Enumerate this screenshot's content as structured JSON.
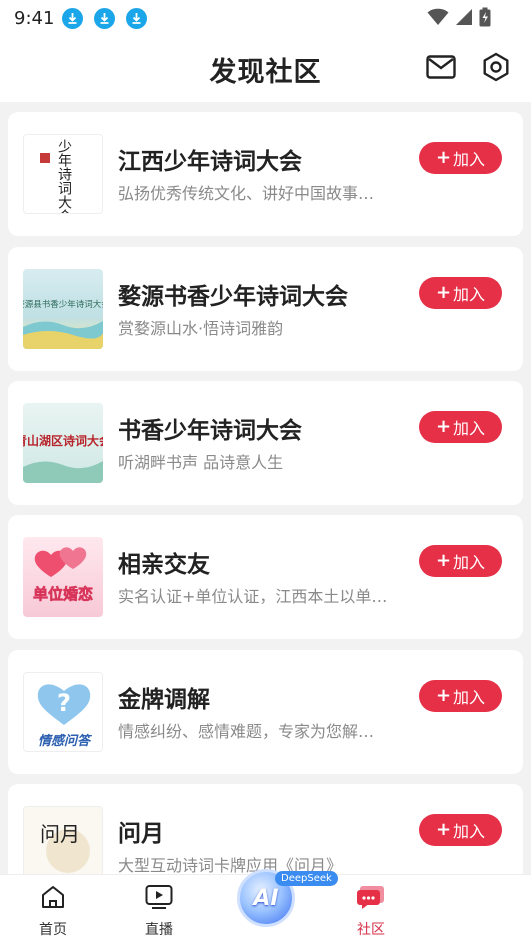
{
  "status_bar": {
    "time": "9:41"
  },
  "header": {
    "title": "发现社区"
  },
  "communities": [
    {
      "title": "江西少年诗词大会",
      "description": "弘扬优秀传统文化、讲好中国故事…",
      "thumb_text": "少年诗词大会",
      "join_label": "加入"
    },
    {
      "title": "婺源书香少年诗词大会",
      "description": "赏婺源山水·悟诗词雅韵",
      "thumb_text": "婺源县书香少年诗词大会",
      "join_label": "加入"
    },
    {
      "title": "书香少年诗词大会",
      "description": "听湖畔书声 品诗意人生",
      "thumb_text": "青山湖区诗词大会",
      "join_label": "加入"
    },
    {
      "title": "相亲交友",
      "description": "实名认证+单位认证，江西本土以单…",
      "thumb_text": "单位婚恋",
      "join_label": "加入"
    },
    {
      "title": "金牌调解",
      "description": "情感纠纷、感情难题，专家为您解…",
      "thumb_text": "情感问答",
      "join_label": "加入"
    },
    {
      "title": "问月",
      "description": "大型互动诗词卡牌应用《问月》",
      "thumb_text": "问月",
      "join_label": "加入"
    }
  ],
  "tabbar": {
    "home": "首页",
    "live": "直播",
    "ai": "AI",
    "ai_badge": "DeepSeek",
    "community": "社区"
  },
  "colors": {
    "accent": "#e63048",
    "active_tab": "#d6304a",
    "download_icon": "#1aa6e8"
  }
}
